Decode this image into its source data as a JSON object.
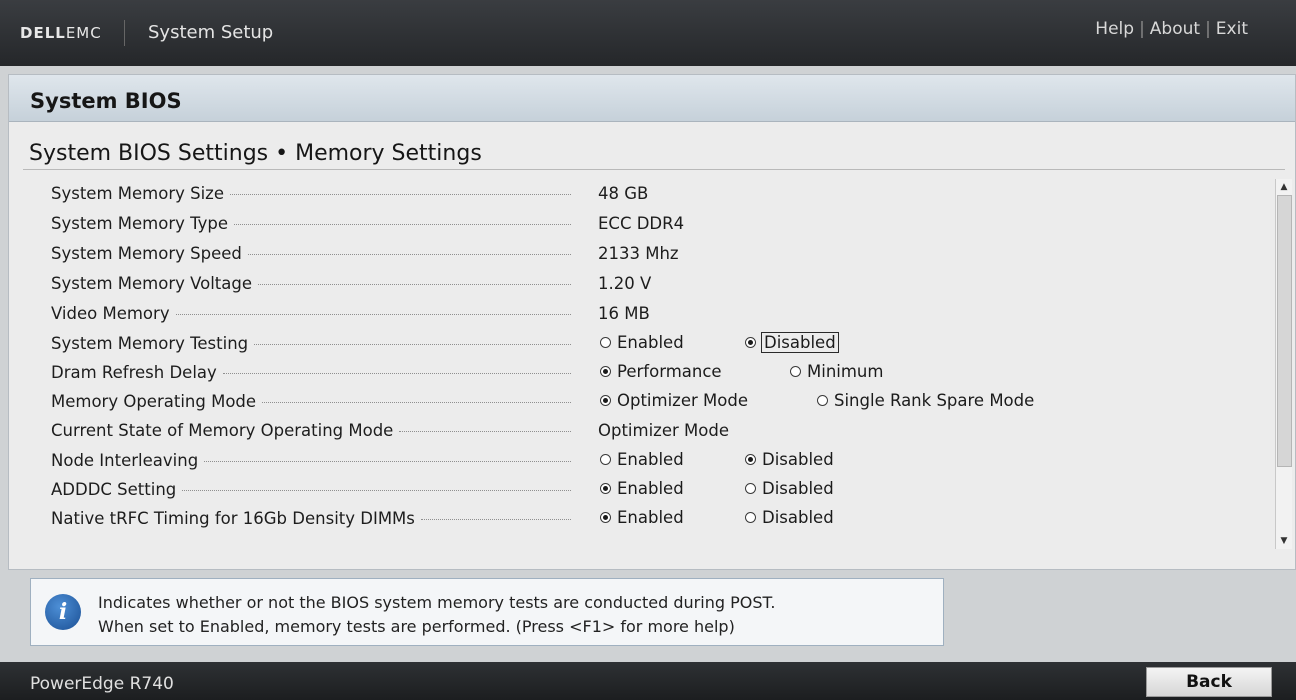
{
  "header": {
    "brand_bold": "DELL",
    "brand_light": "EMC",
    "app_title": "System Setup",
    "links": [
      "Help",
      "About",
      "Exit"
    ]
  },
  "panel": {
    "title": "System BIOS",
    "subtitle": "System BIOS Settings • Memory Settings"
  },
  "settings": [
    {
      "label": "System Memory Size",
      "value": "48 GB"
    },
    {
      "label": "System Memory Type",
      "value": "ECC DDR4"
    },
    {
      "label": "System Memory Speed",
      "value": "2133 Mhz"
    },
    {
      "label": "System Memory Voltage",
      "value": "1.20 V"
    },
    {
      "label": "Video Memory",
      "value": "16 MB"
    },
    {
      "label": "System Memory Testing",
      "options": [
        "Enabled",
        "Disabled"
      ],
      "selected": "Disabled"
    },
    {
      "label": "Dram Refresh Delay",
      "options": [
        "Performance",
        "Minimum"
      ],
      "selected": "Performance"
    },
    {
      "label": "Memory Operating Mode",
      "options": [
        "Optimizer Mode",
        "Single Rank Spare Mode"
      ],
      "selected": "Optimizer Mode"
    },
    {
      "label": "Current State of Memory Operating Mode",
      "value": "Optimizer Mode"
    },
    {
      "label": "Node Interleaving",
      "options": [
        "Enabled",
        "Disabled"
      ],
      "selected": "Disabled"
    },
    {
      "label": "ADDDC Setting",
      "options": [
        "Enabled",
        "Disabled"
      ],
      "selected": "Enabled"
    },
    {
      "label": "Native tRFC Timing for 16Gb Density DIMMs",
      "options": [
        "Enabled",
        "Disabled"
      ],
      "selected": "Enabled"
    }
  ],
  "help": {
    "line1": "Indicates whether or not the BIOS system memory tests are conducted during POST.",
    "line2": "When set to Enabled, memory tests are performed. (Press <F1> for more help)"
  },
  "footer": {
    "model": "PowerEdge R740",
    "back_label": "Back"
  }
}
